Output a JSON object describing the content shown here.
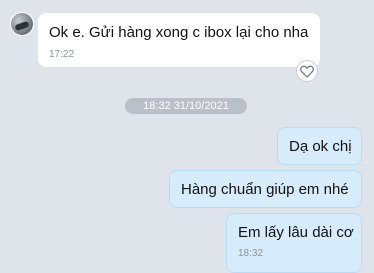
{
  "incoming": {
    "text": "Ok e. Gửi hàng xong c ibox lại cho nha",
    "time": "17:22"
  },
  "date_divider": "18:32 31/10/2021",
  "outgoing": [
    {
      "text": "Dạ ok chị"
    },
    {
      "text": "Hàng chuẩn giúp em nhé"
    },
    {
      "text": "Em lấy lâu dài cơ",
      "time": "18:32"
    }
  ],
  "icons": {
    "avatar": "contact-avatar",
    "reaction": "heart-icon"
  },
  "colors": {
    "background": "#dfe3ea",
    "incoming_bubble": "#ffffff",
    "outgoing_bubble": "#d7ecfb",
    "date_pill": "#b9c0c9"
  }
}
